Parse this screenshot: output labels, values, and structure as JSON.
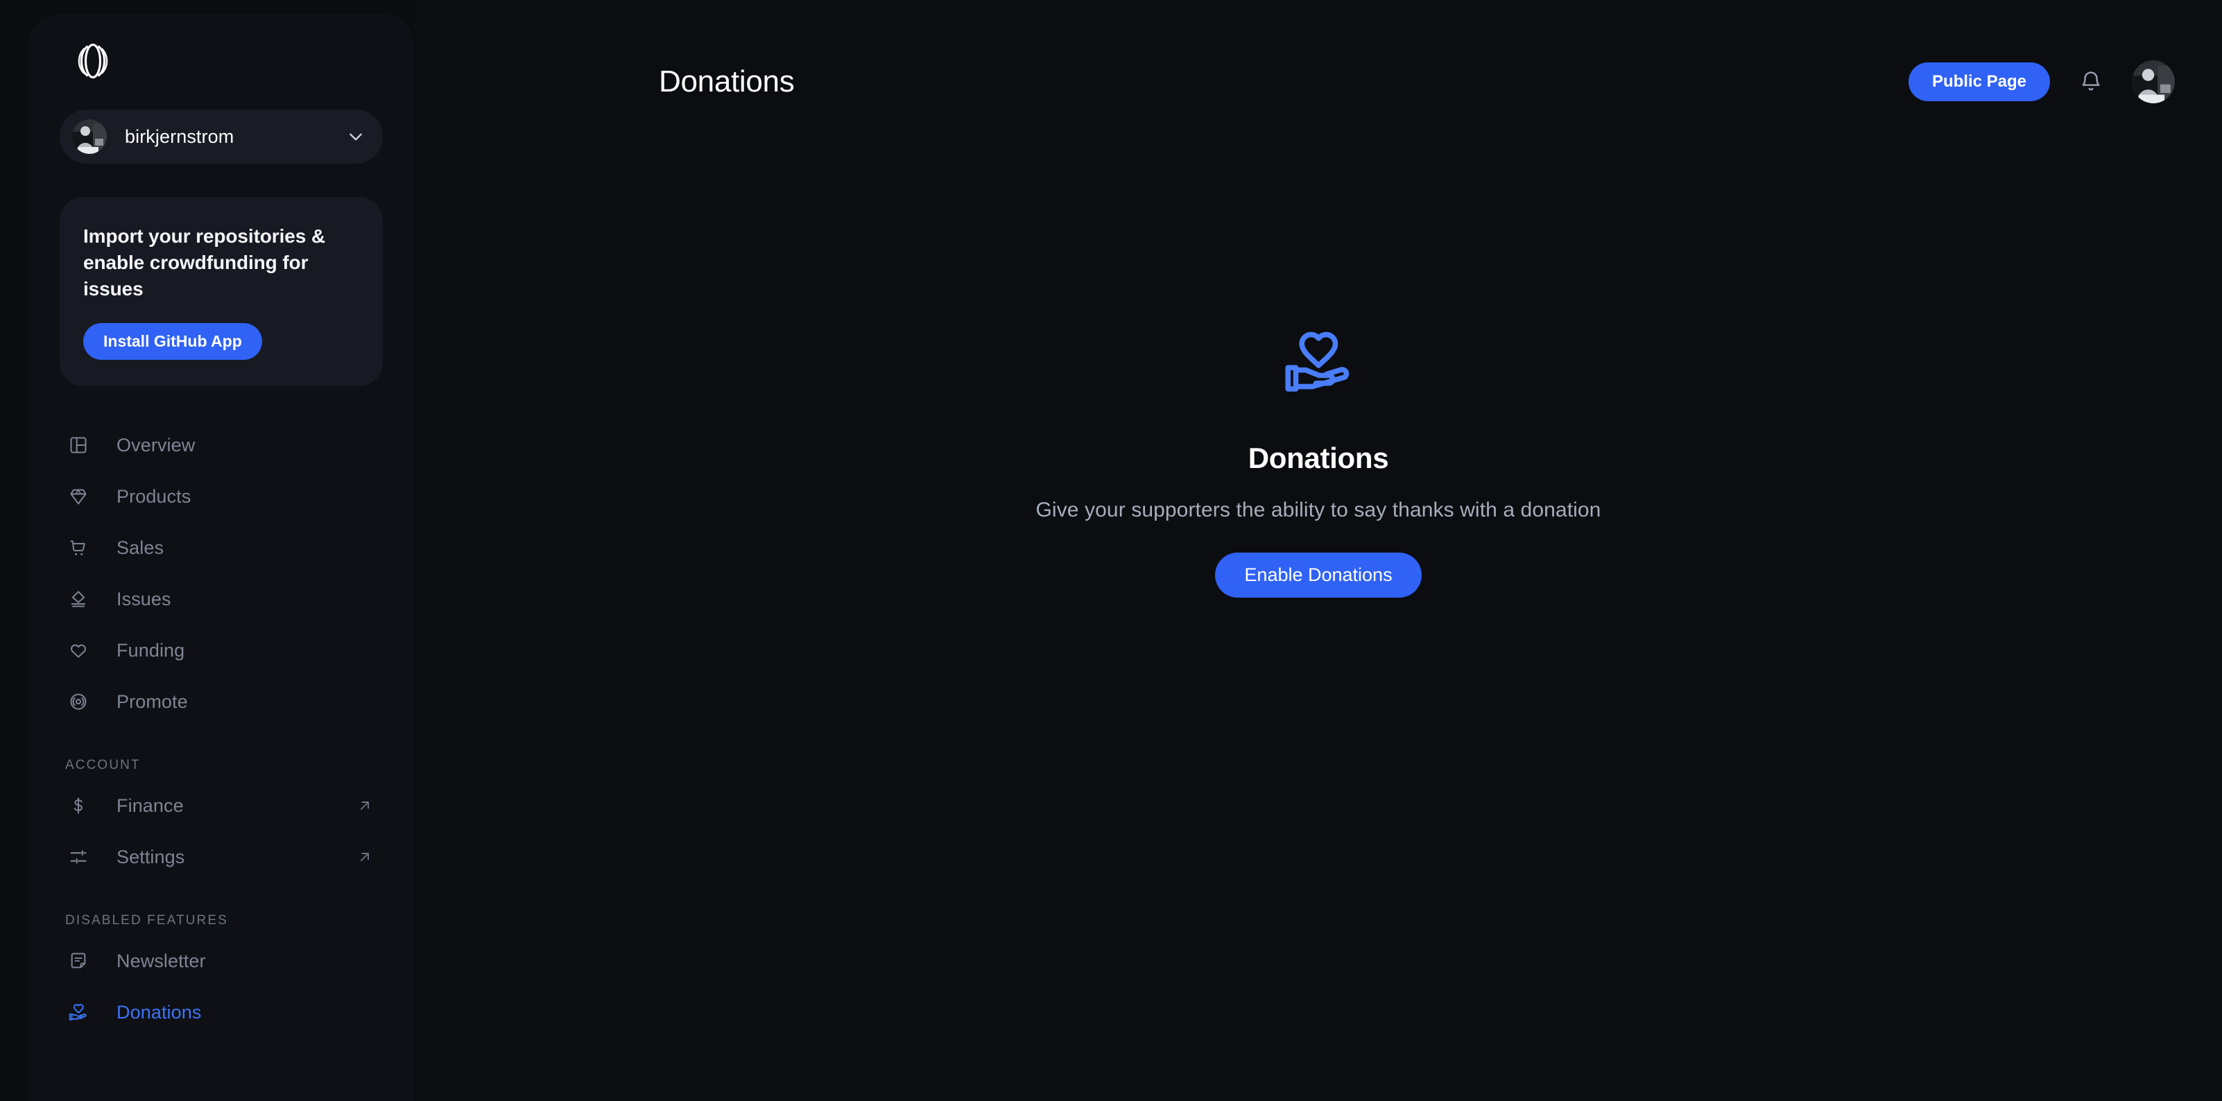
{
  "app": {
    "brand_logo": "polar-logo",
    "accent_color": "#2f62f5"
  },
  "sidebar": {
    "org_switcher": {
      "name": "birkjernstrom",
      "avatar": "user-avatar",
      "chevron": "chevron-down-icon"
    },
    "promo": {
      "title": "Import your repositories & enable crowdfunding for issues",
      "button_label": "Install GitHub App"
    },
    "nav": [
      {
        "label": "Overview",
        "icon": "layout-dashboard-icon",
        "active": false,
        "external": false
      },
      {
        "label": "Products",
        "icon": "diamond-icon",
        "active": false,
        "external": false
      },
      {
        "label": "Sales",
        "icon": "shopping-cart-icon",
        "active": false,
        "external": false
      },
      {
        "label": "Issues",
        "icon": "issues-icon",
        "active": false,
        "external": false
      },
      {
        "label": "Funding",
        "icon": "heart-icon",
        "active": false,
        "external": false
      },
      {
        "label": "Promote",
        "icon": "broadcast-icon",
        "active": false,
        "external": false
      }
    ],
    "account_section_label": "ACCOUNT",
    "account_items": [
      {
        "label": "Finance",
        "icon": "dollar-icon",
        "active": false,
        "external": true
      },
      {
        "label": "Settings",
        "icon": "sliders-icon",
        "active": false,
        "external": true
      }
    ],
    "disabled_section_label": "DISABLED FEATURES",
    "disabled_items": [
      {
        "label": "Newsletter",
        "icon": "note-icon",
        "active": false,
        "external": false
      },
      {
        "label": "Donations",
        "icon": "volunteer-activism-icon",
        "active": true,
        "external": false
      }
    ],
    "external_icon": "arrow-up-right-icon"
  },
  "header": {
    "title": "Donations",
    "public_page_label": "Public Page",
    "notifications_icon": "bell-icon",
    "avatar": "user-avatar"
  },
  "empty_state": {
    "icon": "volunteer-activism-icon",
    "title": "Donations",
    "subtitle": "Give your supporters the ability to say thanks with a donation",
    "button_label": "Enable Donations"
  }
}
